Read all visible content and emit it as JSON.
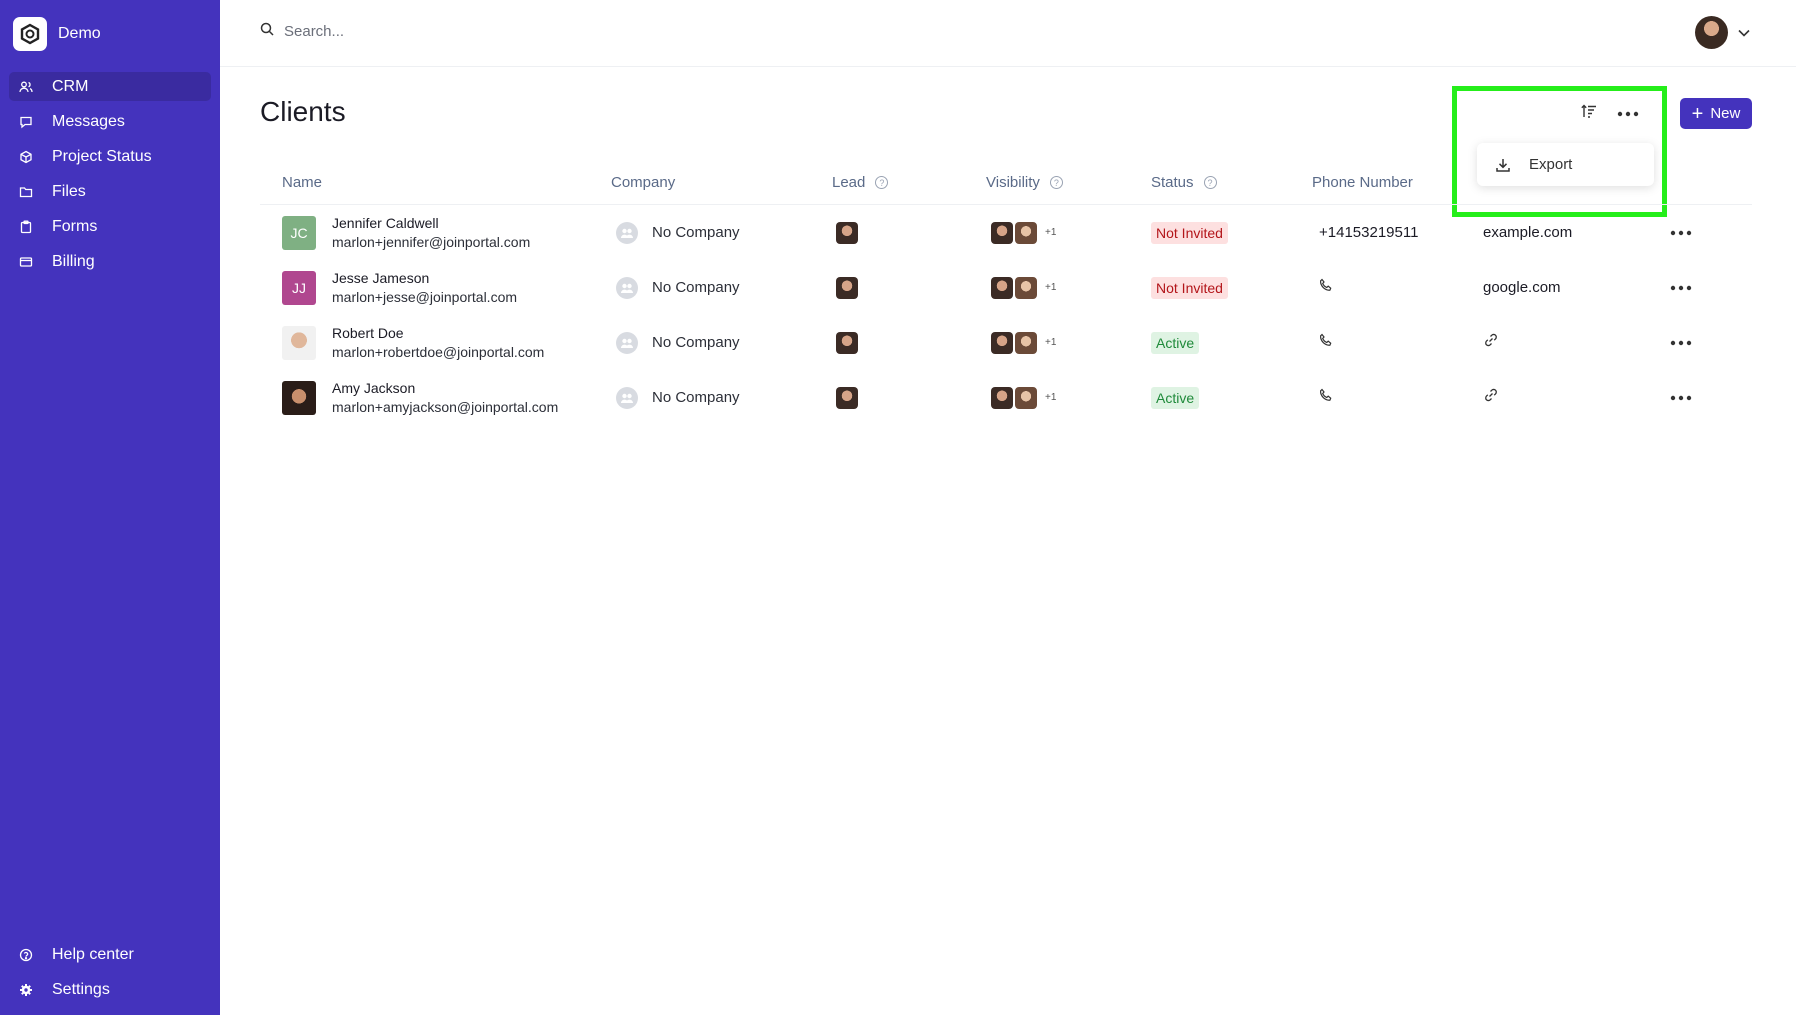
{
  "sidebar": {
    "workspace": "Demo",
    "items": [
      {
        "label": "CRM",
        "icon": "users-icon"
      },
      {
        "label": "Messages",
        "icon": "chat-icon"
      },
      {
        "label": "Project Status",
        "icon": "cube-icon"
      },
      {
        "label": "Files",
        "icon": "folder-icon"
      },
      {
        "label": "Forms",
        "icon": "clipboard-icon"
      },
      {
        "label": "Billing",
        "icon": "card-icon"
      }
    ],
    "bottom": [
      {
        "label": "Help center",
        "icon": "help-icon"
      },
      {
        "label": "Settings",
        "icon": "gear-icon"
      }
    ]
  },
  "search": {
    "placeholder": "Search..."
  },
  "page": {
    "title": "Clients",
    "new_label": "New",
    "export_label": "Export"
  },
  "columns": [
    "Name",
    "Company",
    "Lead",
    "Visibility",
    "Status",
    "Phone Number"
  ],
  "rows": [
    {
      "name": "Jennifer Caldwell",
      "email": "marlon+jennifer@joinportal.com",
      "initials": "JC",
      "avatar_color": "#7fb083",
      "company": "No Company",
      "visibility_more": "+1",
      "status": "Not Invited",
      "phone": "+14153219511",
      "website": "example.com"
    },
    {
      "name": "Jesse Jameson",
      "email": "marlon+jesse@joinportal.com",
      "initials": "JJ",
      "avatar_color": "#b0478f",
      "company": "No Company",
      "visibility_more": "+1",
      "status": "Not Invited",
      "phone": "",
      "website": "google.com"
    },
    {
      "name": "Robert Doe",
      "email": "marlon+robertdoe@joinportal.com",
      "initials": "",
      "company": "No Company",
      "visibility_more": "+1",
      "status": "Active",
      "phone": "",
      "website": ""
    },
    {
      "name": "Amy Jackson",
      "email": "marlon+amyjackson@joinportal.com",
      "initials": "",
      "company": "No Company",
      "visibility_more": "+1",
      "status": "Active",
      "phone": "",
      "website": ""
    }
  ],
  "colors": {
    "brand": "#4433bd",
    "highlight": "#25ee1a",
    "not_invited_bg": "#fde0e0",
    "active_bg": "#dff3e3"
  }
}
